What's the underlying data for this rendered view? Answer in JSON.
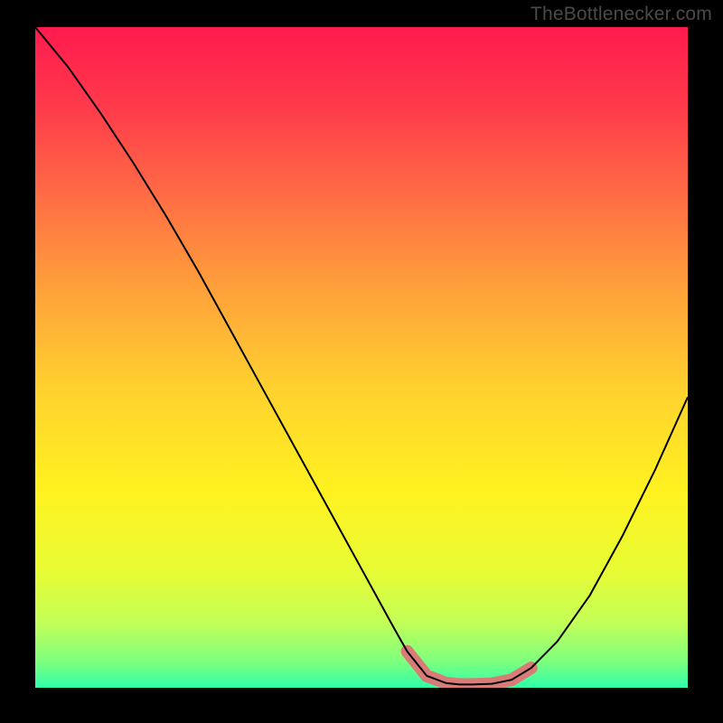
{
  "watermark": "TheBottlenecker.com",
  "chart_data": {
    "type": "line",
    "title": "",
    "xlabel": "",
    "ylabel": "",
    "xlim": [
      0,
      100
    ],
    "ylim": [
      0,
      100
    ],
    "series": [
      {
        "name": "curve",
        "x": [
          0,
          5,
          10,
          15,
          20,
          25,
          30,
          35,
          40,
          45,
          50,
          55,
          57,
          60,
          63,
          65,
          67,
          70,
          73,
          76,
          80,
          85,
          90,
          95,
          100
        ],
        "y": [
          100,
          94,
          87,
          79.5,
          71.5,
          63,
          54,
          45,
          36,
          27,
          18,
          9,
          5.5,
          1.8,
          0.7,
          0.5,
          0.5,
          0.6,
          1.2,
          3,
          7,
          14,
          23,
          33,
          44
        ]
      }
    ],
    "highlight_band": {
      "x_start": 57,
      "x_end": 76,
      "color": "#d97b77",
      "thickness": 14
    },
    "background_gradient": [
      {
        "offset": 0.0,
        "color": "#ff1a4e"
      },
      {
        "offset": 0.12,
        "color": "#ff3a4b"
      },
      {
        "offset": 0.25,
        "color": "#ff6a45"
      },
      {
        "offset": 0.4,
        "color": "#ffa23a"
      },
      {
        "offset": 0.55,
        "color": "#ffd22e"
      },
      {
        "offset": 0.7,
        "color": "#fff120"
      },
      {
        "offset": 0.82,
        "color": "#e8fb33"
      },
      {
        "offset": 0.9,
        "color": "#c4ff56"
      },
      {
        "offset": 0.96,
        "color": "#7eff7e"
      },
      {
        "offset": 1.0,
        "color": "#2fffaa"
      }
    ]
  }
}
